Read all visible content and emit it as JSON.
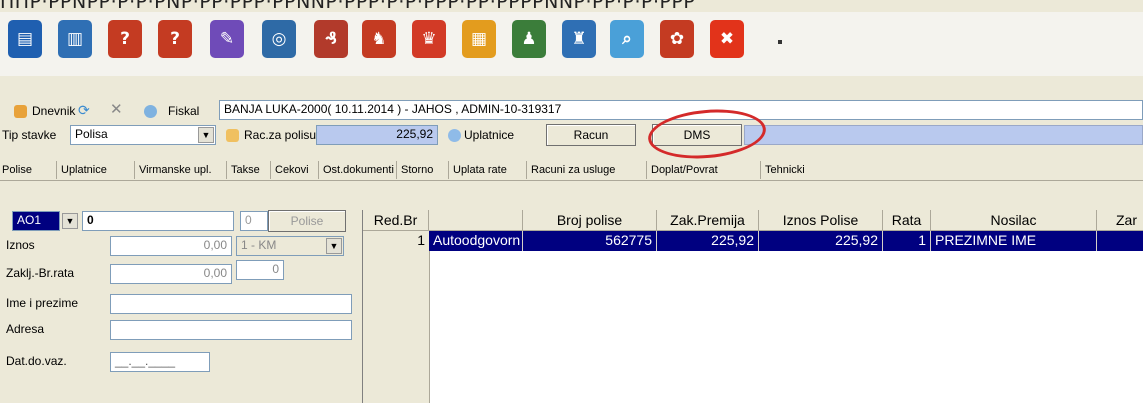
{
  "top_cut_text": "ППP·PPNPP·P·P·PNP·PP·PPP·PPNNP·PPP·P·P·PPP·PP·PPPPNNP·PP·P·P·PPP",
  "toolbar": {
    "icons": [
      {
        "name": "open-icon",
        "glyph": "▤",
        "color": "#1f5fb0"
      },
      {
        "name": "database-icon",
        "glyph": "▥",
        "color": "#2f6fb4"
      },
      {
        "name": "ribbon-question-icon",
        "glyph": "?",
        "color": "#c43b22"
      },
      {
        "name": "ribbon-user-icon",
        "glyph": "?",
        "color": "#c43b22"
      },
      {
        "name": "edit-document-icon",
        "glyph": "✎",
        "color": "#6f4bb8"
      },
      {
        "name": "network-icon",
        "glyph": "◎",
        "color": "#2e6aa6"
      },
      {
        "name": "currency-icon",
        "glyph": "₰",
        "color": "#b23a2b"
      },
      {
        "name": "ribbon-people-icon",
        "glyph": "♞",
        "color": "#c43b22"
      },
      {
        "name": "ribbon-award-icon",
        "glyph": "♛",
        "color": "#d23a26"
      },
      {
        "name": "calendar-icon",
        "glyph": "▦",
        "color": "#e39c1e"
      },
      {
        "name": "users-group-icon",
        "glyph": "♟",
        "color": "#3b7d3a"
      },
      {
        "name": "shield-people-icon",
        "glyph": "♜",
        "color": "#2f6fb4"
      },
      {
        "name": "preview-document-icon",
        "glyph": "⌕",
        "color": "#4aa0d8"
      },
      {
        "name": "ribbon-gear-icon",
        "glyph": "✿",
        "color": "#c43b22"
      },
      {
        "name": "close-icon",
        "glyph": "✖",
        "color": "#e2331a"
      }
    ]
  },
  "row1": {
    "dnevnik_label": "Dnevnik",
    "fiskal_label": "Fiskal",
    "info_value": "BANJA LUKA-2000( 10.11.2014 ) - JAHOS , ADMIN-10-319317"
  },
  "row2": {
    "tip_stavke_label": "Tip stavke",
    "tip_stavke_value": "Polisa",
    "rac_za_polisu_label": "Rac.za polisu",
    "rac_za_polisu_value": "225,92",
    "uplatnice_label": "Uplatnice",
    "racun_button": "Racun",
    "dms_button": "DMS"
  },
  "tabs": [
    "Polise",
    "Uplatnice",
    "Virmanske upl.",
    "Takse",
    "Cekovi",
    "Ost.dokumenti",
    "Storno",
    "Uplata rate",
    "Racuni za usluge",
    "Doplat/Povrat",
    "Tehnicki"
  ],
  "panel": {
    "code_value": "AO1",
    "number_value": "0",
    "small_value": "0",
    "polise_button": "Polise",
    "iznos_label": "Iznos",
    "iznos_value": "0,00",
    "currency_value": "1 - KM",
    "zaklj_label": "Zaklj.-Br.rata",
    "zaklj_value": "0,00",
    "br_rata_value": "0",
    "ime_label": "Ime i prezime",
    "adresa_label": "Adresa",
    "dat_label": "Dat.do.vaz.",
    "dat_value": "__.__.____"
  },
  "grid": {
    "headers": [
      "Red.Br",
      "",
      "Broj polise",
      "Zak.Premija",
      "Iznos Polise",
      "Rata",
      "Nosilac",
      "Zar"
    ],
    "rows": [
      [
        "1",
        "Autoodgovorn",
        "562775",
        "225,92",
        "225,92",
        "1",
        "PREZIMNE IME",
        ""
      ]
    ]
  },
  "colors": {
    "selection": "#000080",
    "annotation_ring": "#d42a2a",
    "highlight_field": "#b9c9ee"
  }
}
